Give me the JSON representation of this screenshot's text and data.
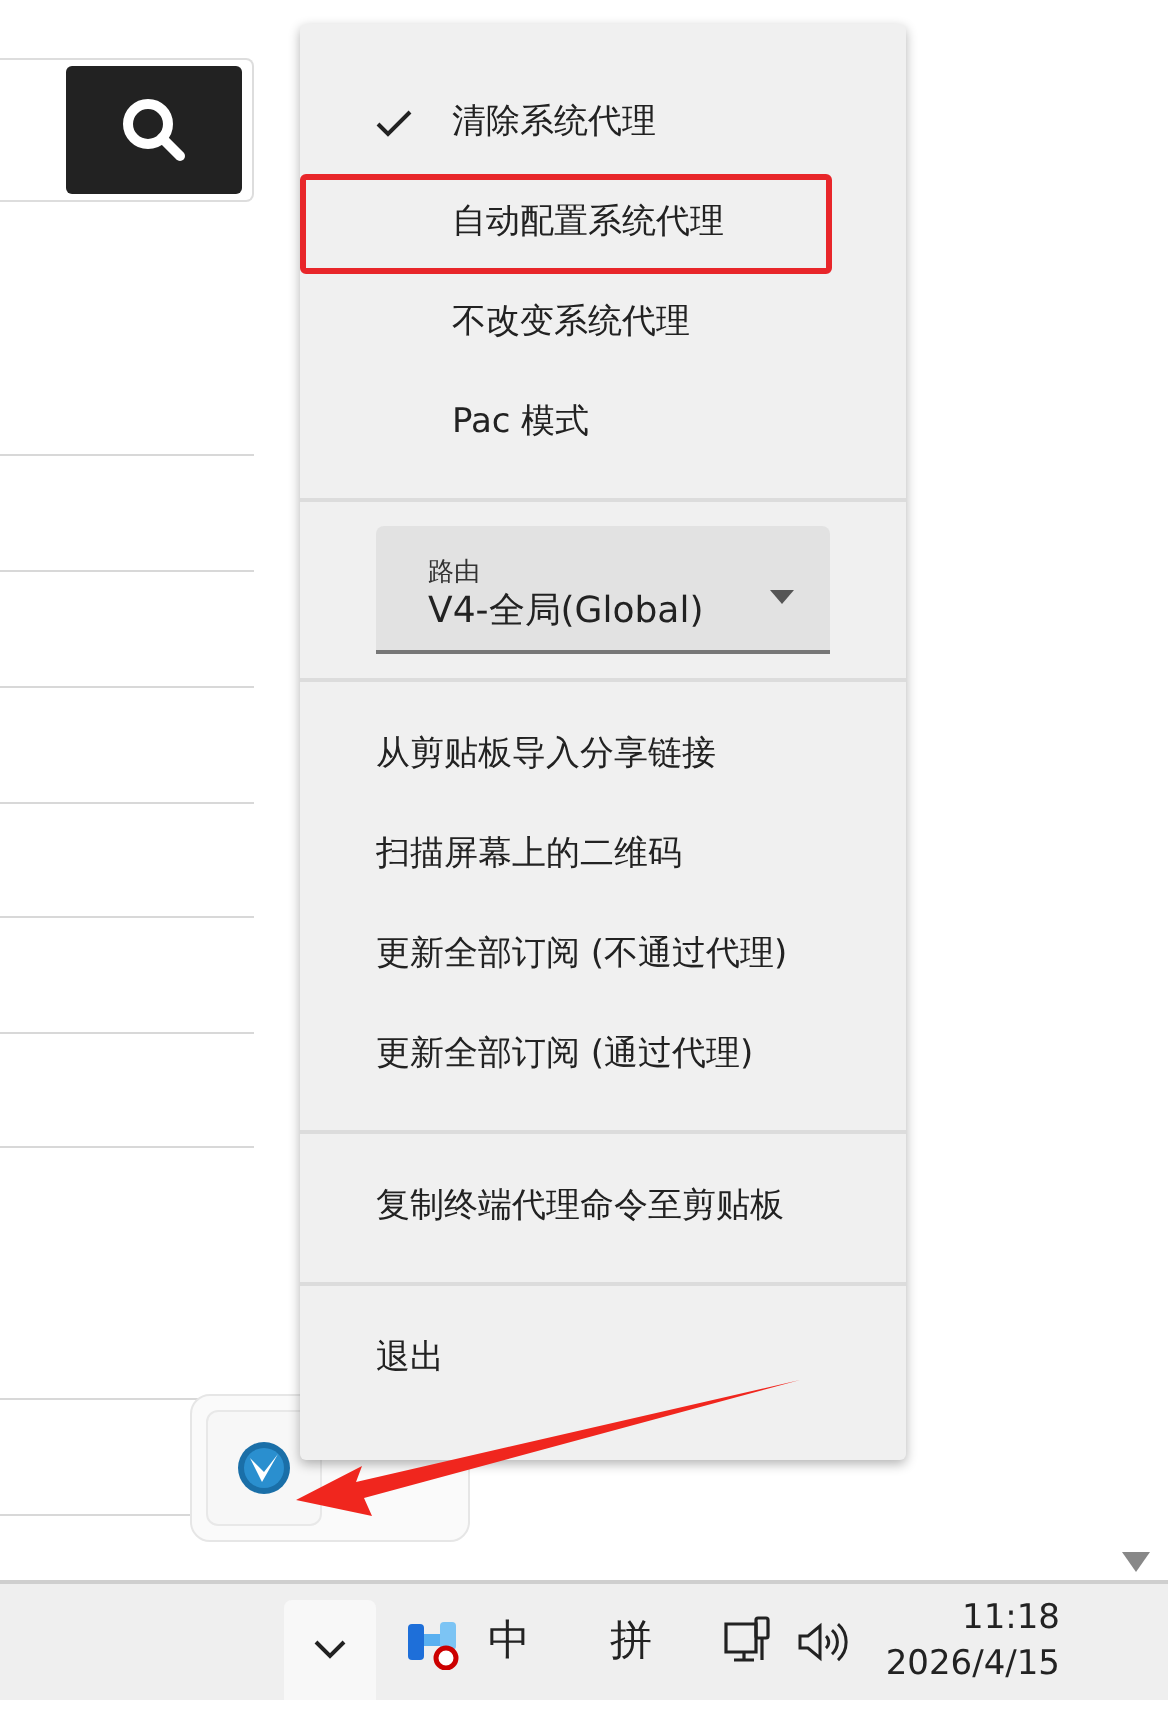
{
  "proxy_modes": [
    {
      "label": "清除系统代理",
      "checked": true,
      "highlighted": false
    },
    {
      "label": "自动配置系统代理",
      "checked": false,
      "highlighted": true
    },
    {
      "label": "不改变系统代理",
      "checked": false,
      "highlighted": false
    },
    {
      "label": "Pac 模式",
      "checked": false,
      "highlighted": false
    }
  ],
  "route": {
    "label": "路由",
    "value": "V4-全局(Global)"
  },
  "action_groups": [
    [
      "从剪贴板导入分享链接",
      "扫描屏幕上的二维码",
      "更新全部订阅 (不通过代理)",
      "更新全部订阅 (通过代理)"
    ],
    [
      "复制终端代理命令至剪贴板"
    ],
    [
      "退出"
    ]
  ],
  "taskbar": {
    "ime_language": "中",
    "ime_mode": "拼",
    "time": "11:18",
    "date": "2026/4/15"
  }
}
